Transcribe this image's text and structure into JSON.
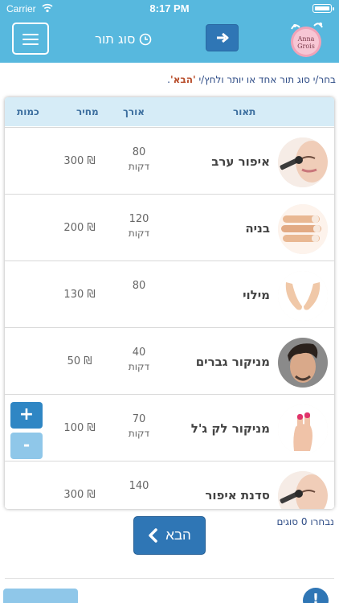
{
  "status_bar": {
    "carrier": "Carrier",
    "time": "8:17 PM"
  },
  "header": {
    "title": "סוג תור",
    "logo_line1": "Anna",
    "logo_line2": "Grois"
  },
  "instruction": {
    "prefix": "בחר/י סוג תור אחד או יותר ולחץ/י ",
    "highlight": "'הבא'",
    "suffix": "."
  },
  "table": {
    "headers": {
      "description": "תאור",
      "length": "אורך",
      "price": "מחיר",
      "quantity": "כמות"
    },
    "rows": [
      {
        "name": "איפור ערב",
        "length": "80",
        "unit": "דקות",
        "price": "300 ₪",
        "icon": "makeup-brush-face"
      },
      {
        "name": "בניה",
        "length": "120",
        "unit": "דקות",
        "price": "200 ₪",
        "icon": "nails-hand"
      },
      {
        "name": "מילוי",
        "length": "80",
        "unit": "",
        "price": "130 ₪",
        "icon": "cupped-hands"
      },
      {
        "name": "מניקור גברים",
        "length": "40",
        "unit": "דקות",
        "price": "50 ₪",
        "icon": "man-face"
      },
      {
        "name": "מניקור לק ג'ל",
        "length": "70",
        "unit": "דקות",
        "price": "100 ₪",
        "icon": "painted-nails-hand",
        "plus": "+",
        "minus": "-"
      },
      {
        "name": "סדנת איפור",
        "length": "140",
        "unit": "",
        "price": "300 ₪",
        "icon": "makeup-brush-face"
      }
    ]
  },
  "footer": {
    "selected_count": "נבחרו 0 סוגים",
    "next_label": "הבא"
  },
  "colors": {
    "header": "#57b8de",
    "primary_button": "#2f76b5",
    "table_header": "#d6ecf7"
  }
}
